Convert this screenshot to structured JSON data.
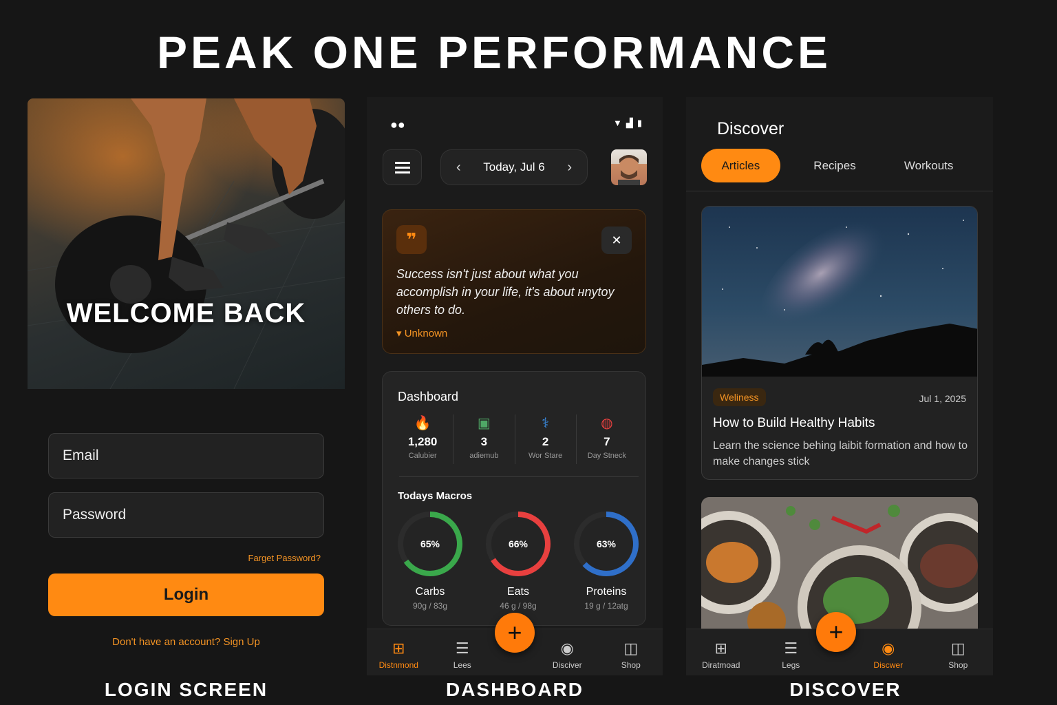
{
  "title": "PEAK ONE PERFORMANCE",
  "captions": {
    "login": "LOGIN SCREEN",
    "dashboard": "DASHBOARD",
    "discover": "DISCOVER"
  },
  "login": {
    "welcome": "WELCOME BACK",
    "email_placeholder": "Email",
    "password_placeholder": "Password",
    "forgot": "Farget Password?",
    "login_label": "Login",
    "signup": "Don't have an account? Sign Up"
  },
  "dashboard": {
    "date": "Today, Jul 6",
    "quote": {
      "text": "Success isn't just about what you accomplish in your life, it's about ʜnytoy others to do.",
      "author": "Unknown"
    },
    "card_title": "Dashboard",
    "stats": [
      {
        "icon": "flame-icon",
        "value": "1,280",
        "label": "Calubier"
      },
      {
        "icon": "journal-icon",
        "value": "3",
        "label": "adiemub"
      },
      {
        "icon": "workout-icon",
        "value": "2",
        "label": "Wor Stare"
      },
      {
        "icon": "streak-icon",
        "value": "7",
        "label": "Day Stneck"
      }
    ],
    "macros_title": "Todays Macros",
    "macros": [
      {
        "name": "Carbs",
        "percent": "65%",
        "fraction": 0.65,
        "detail": "90g / 83g",
        "color": "#3aa84b"
      },
      {
        "name": "Eats",
        "percent": "66%",
        "fraction": 0.66,
        "detail": "46 g / 98g",
        "color": "#e8403f"
      },
      {
        "name": "Proteins",
        "percent": "63%",
        "fraction": 0.63,
        "detail": "19 g / 12atg",
        "color": "#2f6fc9"
      }
    ],
    "nav": [
      {
        "label": "Distnmond",
        "icon": "grid-icon",
        "active": true
      },
      {
        "label": "Lees",
        "icon": "log-icon",
        "active": false
      },
      {
        "label": "Disciver",
        "icon": "compass-icon",
        "active": false
      },
      {
        "label": "Shop",
        "icon": "bag-icon",
        "active": false
      }
    ],
    "fab": "+"
  },
  "discover": {
    "title": "Discover",
    "tabs": [
      "Articles",
      "Recipes",
      "Workouts"
    ],
    "active_tab": "Articles",
    "article": {
      "badge": "Weliness",
      "date": "Jul 1, 2025",
      "title": "How to Build Healthy Habits",
      "description": "Learn the science behing laibit formation and how to make changes stick"
    },
    "nav": [
      {
        "label": "Diratmoad",
        "icon": "grid-icon",
        "active": false
      },
      {
        "label": "Legs",
        "icon": "log-icon",
        "active": false
      },
      {
        "label": "Discwer",
        "icon": "compass-icon",
        "active": true
      },
      {
        "label": "Shop",
        "icon": "bag-icon",
        "active": false
      }
    ],
    "fab": "+"
  },
  "colors": {
    "accent": "#ff8a12",
    "background": "#161616",
    "card": "#242424"
  }
}
